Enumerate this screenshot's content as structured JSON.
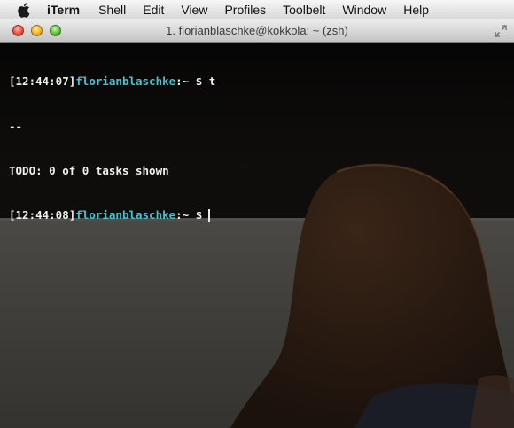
{
  "menubar": {
    "apple_icon": "apple-logo-icon",
    "app_name": "iTerm",
    "items": [
      "Shell",
      "Edit",
      "View",
      "Profiles",
      "Toolbelt",
      "Window",
      "Help"
    ]
  },
  "window": {
    "title": "1. florianblaschke@kokkola: ~ (zsh)"
  },
  "terminal": {
    "lines": [
      {
        "timestamp": "[12:44:07]",
        "user": "florianblaschke",
        "path": ":~ $ ",
        "command": "t"
      },
      {
        "output": "--"
      },
      {
        "output": "TODO: 0 of 0 tasks shown"
      },
      {
        "timestamp": "[12:44:08]",
        "user": "florianblaschke",
        "path": ":~ $",
        "command": ""
      }
    ],
    "colors": {
      "text": "#efefef",
      "user": "#3fc6d2"
    }
  }
}
